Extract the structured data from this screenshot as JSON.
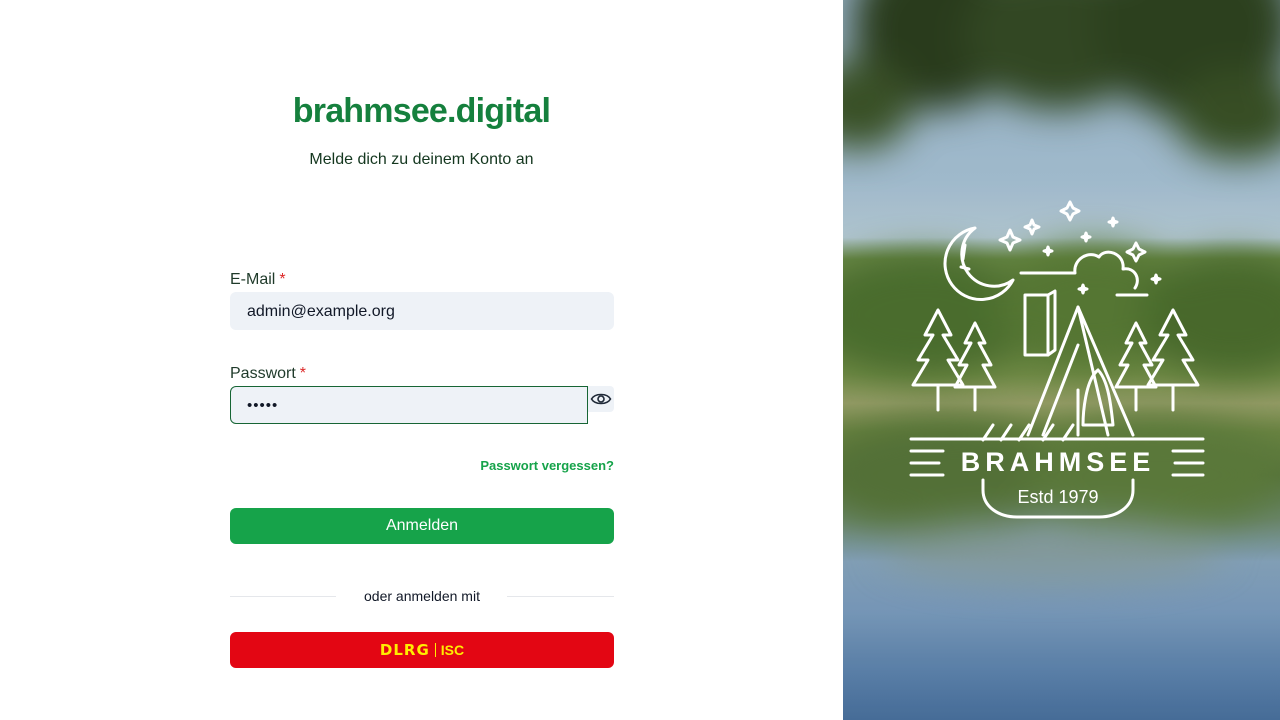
{
  "brand": {
    "title": "brahmsee.digital",
    "subtitle": "Melde dich zu deinem Konto an"
  },
  "form": {
    "email": {
      "label": "E-Mail",
      "required_mark": "*",
      "value": "admin@example.org"
    },
    "password": {
      "label": "Passwort",
      "required_mark": "*",
      "value": "•••••"
    },
    "forgot_password": "Passwort vergessen?",
    "submit_label": "Anmelden"
  },
  "divider_text": "oder anmelden mit",
  "sso": {
    "provider_name": "DLRG",
    "provider_suffix": "ISC"
  },
  "side_image": {
    "logo_name": "BRAHMSEE",
    "logo_established": "Estd 1979"
  },
  "colors": {
    "brand_green": "#15803d",
    "button_green": "#16a34a",
    "input_background": "#eef2f7",
    "sso_red": "#e30613",
    "sso_yellow": "#ffed00",
    "required_red": "#dc2626"
  },
  "icons": {
    "password_toggle": "eye-icon",
    "side_logo": "camping-logo"
  }
}
